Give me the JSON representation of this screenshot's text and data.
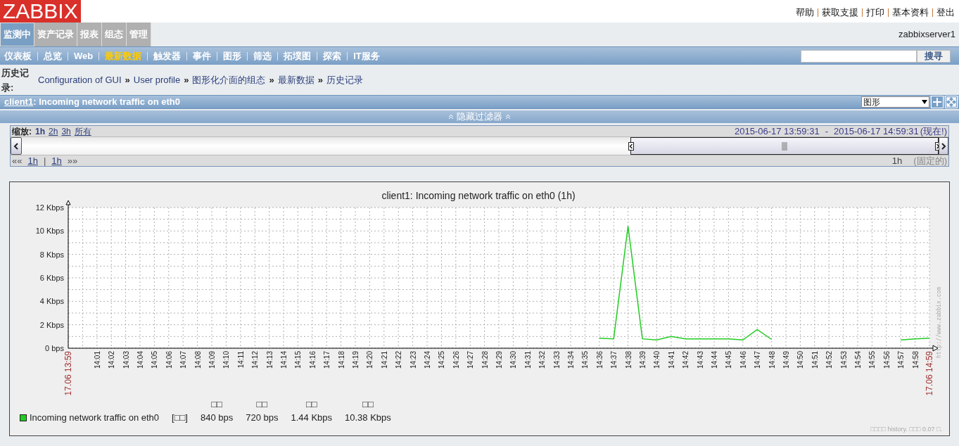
{
  "logo": "ZABBIX",
  "header_links": [
    "帮助",
    "获取支援",
    "打印",
    "基本资料",
    "登出"
  ],
  "main_tabs": [
    {
      "label": "监测中",
      "selected": true
    },
    {
      "label": "资产记录",
      "selected": false
    },
    {
      "label": "报表",
      "selected": false
    },
    {
      "label": "组态",
      "selected": false
    },
    {
      "label": "管理",
      "selected": false
    }
  ],
  "server_name": "zabbixserver1",
  "sub_nav": [
    {
      "label": "仪表板",
      "selected": false
    },
    {
      "label": "总览",
      "selected": false
    },
    {
      "label": "Web",
      "selected": false
    },
    {
      "label": "最新数据",
      "selected": true
    },
    {
      "label": "触发器",
      "selected": false
    },
    {
      "label": "事件",
      "selected": false
    },
    {
      "label": "图形",
      "selected": false
    },
    {
      "label": "筛选",
      "selected": false
    },
    {
      "label": "拓墣图",
      "selected": false
    },
    {
      "label": "探索",
      "selected": false
    },
    {
      "label": "IT服务",
      "selected": false
    }
  ],
  "search": {
    "button": "搜寻"
  },
  "breadcrumb": {
    "label": "历史记录:",
    "separator": "»",
    "items": [
      "Configuration of GUI",
      "User profile",
      "图形化介面的组态",
      "最新数据",
      "历史记录"
    ]
  },
  "title_bar": {
    "host": "client1",
    "text": ": Incoming network traffic on eth0",
    "view_select": "图形"
  },
  "filter_toggle": "隐藏过滤器",
  "timeline": {
    "zoom_label": "缩放:",
    "zoom_options": [
      {
        "label": "1h",
        "selected": true
      },
      {
        "label": "2h",
        "selected": false
      },
      {
        "label": "3h",
        "selected": false
      },
      {
        "label": "所有",
        "selected": false
      }
    ],
    "range_start": "2015-06-17 13:59:31",
    "range_sep": "-",
    "range_end": "2015-06-17 14:59:31",
    "now": "(现在!)",
    "back": "««",
    "back_step": "1h",
    "nav_sep": "|",
    "fwd_step": "1h",
    "forward": "»»",
    "period": "1h",
    "fixed": "(固定的)"
  },
  "graph": {
    "watermark": "http://www.zabbix.com",
    "legend": {
      "func": "[□□]",
      "columns": [
        {
          "header": "□□",
          "value": "840 bps"
        },
        {
          "header": "□□",
          "value": "720 bps"
        },
        {
          "header": "□□",
          "value": "1.44 Kbps"
        },
        {
          "header": "□□",
          "value": "10.38 Kbps"
        }
      ]
    },
    "footer": "□□□□ history. □□□ 0.07 □.",
    "chart_data": {
      "type": "line",
      "title": "client1: Incoming network traffic on eth0 (1h)",
      "categories": [
        "17.06 13:59",
        null,
        "14:01",
        "14:02",
        "14:03",
        "14:04",
        "14:05",
        "14:06",
        "14:07",
        "14:08",
        "14:09",
        "14:10",
        "14:11",
        "14:12",
        "14:13",
        "14:14",
        "14:15",
        "14:16",
        "14:17",
        "14:18",
        "14:19",
        "14:20",
        "14:21",
        "14:22",
        "14:23",
        "14:24",
        "14:25",
        "14:26",
        "14:27",
        "14:28",
        "14:29",
        "14:30",
        "14:31",
        "14:32",
        "14:33",
        "14:34",
        "14:35",
        "14:36",
        "14:37",
        "14:38",
        "14:39",
        "14:40",
        "14:41",
        "14:42",
        "14:43",
        "14:44",
        "14:45",
        "14:46",
        "14:47",
        "14:48",
        "14:49",
        "14:50",
        "14:51",
        "14:52",
        "14:53",
        "14:54",
        "14:55",
        "14:56",
        "14:57",
        "14:58",
        "17.06 14:59"
      ],
      "series": [
        {
          "name": "Incoming network traffic on eth0",
          "color": "#22cc22",
          "values": [
            null,
            null,
            null,
            null,
            null,
            null,
            null,
            null,
            null,
            null,
            null,
            null,
            null,
            null,
            null,
            null,
            null,
            null,
            null,
            null,
            null,
            null,
            null,
            null,
            null,
            null,
            null,
            null,
            null,
            null,
            null,
            null,
            null,
            null,
            null,
            null,
            null,
            0.85,
            0.8,
            10.4,
            0.8,
            0.7,
            1.0,
            0.8,
            0.8,
            0.8,
            0.8,
            0.7,
            1.6,
            0.75,
            null,
            null,
            null,
            null,
            null,
            null,
            null,
            null,
            0.7,
            0.8,
            0.85
          ]
        }
      ],
      "ylim": [
        0,
        12
      ],
      "grid": true,
      "yticks": [
        {
          "value": 0,
          "label": "0 bps"
        },
        {
          "value": 2,
          "label": "2 Kbps"
        },
        {
          "value": 4,
          "label": "4 Kbps"
        },
        {
          "value": 6,
          "label": "6 Kbps"
        },
        {
          "value": 8,
          "label": "8 Kbps"
        },
        {
          "value": 10,
          "label": "10 Kbps"
        },
        {
          "value": 12,
          "label": "12 Kbps"
        }
      ]
    }
  }
}
